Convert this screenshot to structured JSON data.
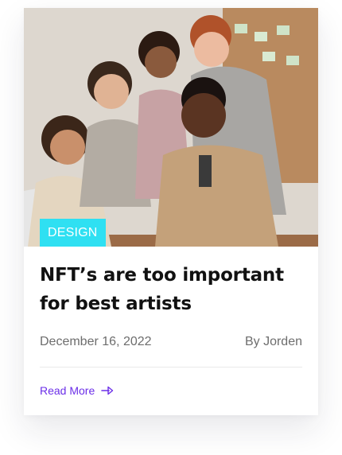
{
  "card": {
    "image_alt": "Group of people looking at a laptop",
    "category": "DESIGN",
    "title": "NFT’s are too important for best artists",
    "date": "December 16, 2022",
    "author": "By Jorden",
    "read_more": "Read More",
    "read_more_icon": "arrow-right-icon"
  },
  "colors": {
    "badge_bg": "#2fe0f2",
    "accent": "#6b2ee8",
    "title": "#111111",
    "meta": "#6d6d6d"
  }
}
